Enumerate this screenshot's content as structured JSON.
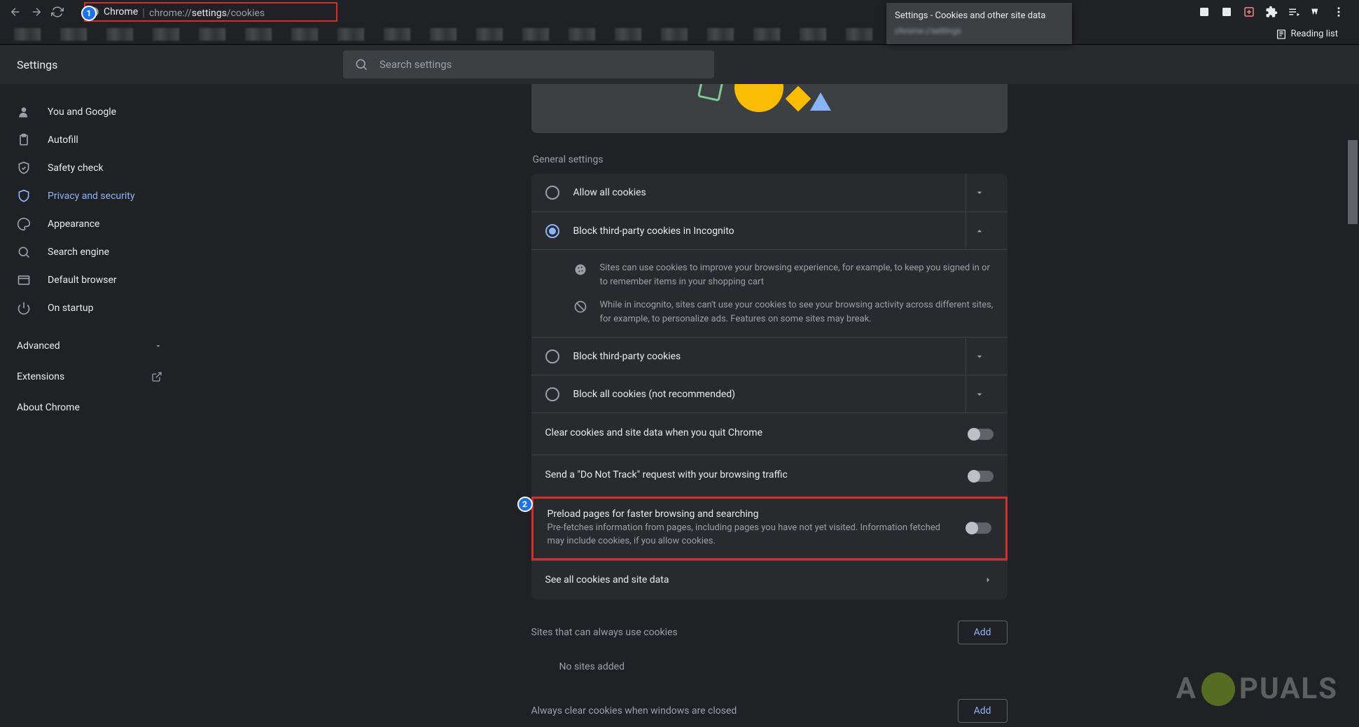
{
  "browser": {
    "url_prefix": "Chrome",
    "url_dim1": "chrome://",
    "url_bold": "settings",
    "url_dim2": "/cookies",
    "tooltip_title": "Settings - Cookies and other site data",
    "tooltip_sub": "chrome://settings",
    "reading_list": "Reading list"
  },
  "header": {
    "title": "Settings",
    "search_placeholder": "Search settings"
  },
  "sidebar": {
    "items": [
      {
        "label": "You and Google"
      },
      {
        "label": "Autofill"
      },
      {
        "label": "Safety check"
      },
      {
        "label": "Privacy and security"
      },
      {
        "label": "Appearance"
      },
      {
        "label": "Search engine"
      },
      {
        "label": "Default browser"
      },
      {
        "label": "On startup"
      }
    ],
    "advanced": "Advanced",
    "extensions": "Extensions",
    "about": "About Chrome"
  },
  "content": {
    "general_label": "General settings",
    "options": [
      {
        "label": "Allow all cookies"
      },
      {
        "label": "Block third-party cookies in Incognito"
      },
      {
        "label": "Block third-party cookies"
      },
      {
        "label": "Block all cookies (not recommended)"
      }
    ],
    "detail1": "Sites can use cookies to improve your browsing experience, for example, to keep you signed in or to remember items in your shopping cart",
    "detail2": "While in incognito, sites can't use your cookies to see your browsing activity across different sites, for example, to personalize ads. Features on some sites may break.",
    "clear_on_quit": "Clear cookies and site data when you quit Chrome",
    "dnt": "Send a \"Do Not Track\" request with your browsing traffic",
    "preload_title": "Preload pages for faster browsing and searching",
    "preload_sub": "Pre-fetches information from pages, including pages you have not yet visited. Information fetched may include cookies, if you allow cookies.",
    "see_all": "See all cookies and site data",
    "always_label": "Sites that can always use cookies",
    "always_empty": "No sites added",
    "clear_close_label": "Always clear cookies when windows are closed",
    "add_btn": "Add"
  },
  "annotations": {
    "one": "1",
    "two": "2"
  },
  "watermark": "PUALS"
}
